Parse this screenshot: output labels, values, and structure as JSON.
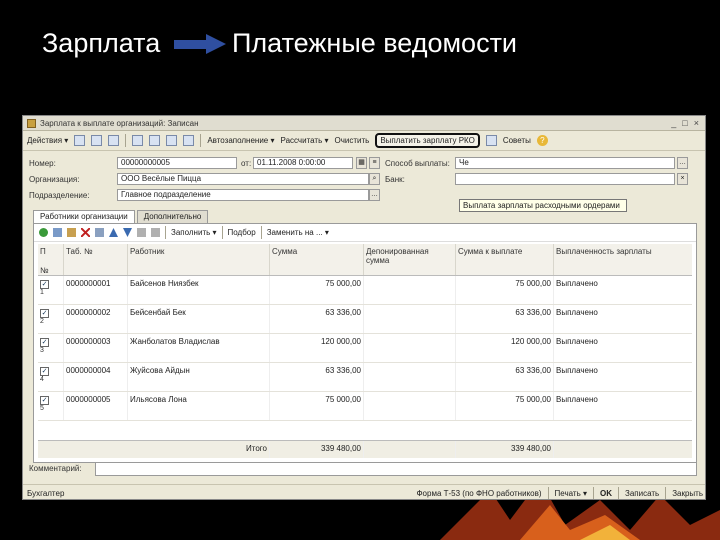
{
  "slide": {
    "crumb_from": "Зарплата",
    "crumb_to": "Платежные ведомости"
  },
  "window": {
    "title": "Зарплата к выплате организаций: Записан"
  },
  "toolbar": {
    "actions": "Действия",
    "autofill": "Автозаполнение",
    "calculate": "Рассчитать",
    "clear": "Очистить",
    "pay_rko": "Выплатить зарплату РКО",
    "tips": "Советы"
  },
  "form": {
    "number_label": "Номер:",
    "number_value": "00000000005",
    "date_label": "от:",
    "date_value": "01.11.2008 0:00:00",
    "payment_method_label": "Способ выплаты:",
    "payment_method_value": "Че",
    "org_label": "Организация:",
    "org_value": "ООО Весёлые Пицца",
    "bank_label": "Банк:",
    "dept_label": "Подразделение:",
    "dept_value": "Главное подразделение",
    "tooltip": "Выплата зарплаты расходными ордерами"
  },
  "tabs": [
    {
      "label": "Работники организации"
    },
    {
      "label": "Дополнительно"
    }
  ],
  "grid_toolbar": {
    "fill": "Заполнить",
    "select": "Подбор",
    "replace": "Заменить на ..."
  },
  "grid": {
    "headers": [
      "П",
      "Таб. №",
      "Работник",
      "Сумма",
      "Депонированная сумма",
      "Сумма к выплате",
      "Выплаченность зарплаты"
    ],
    "num_header": "№",
    "rows": [
      {
        "n": "1",
        "tab": "0000000001",
        "worker": "Байсенов Ниязбек",
        "sum": "75 000,00",
        "pay": "75 000,00",
        "status": "Выплачено"
      },
      {
        "n": "2",
        "tab": "0000000002",
        "worker": "Бейсенбай Бек",
        "sum": "63 336,00",
        "pay": "63 336,00",
        "status": "Выплачено"
      },
      {
        "n": "3",
        "tab": "0000000003",
        "worker": "Жанболатов Владислав",
        "sum": "120 000,00",
        "pay": "120 000,00",
        "status": "Выплачено"
      },
      {
        "n": "4",
        "tab": "0000000004",
        "worker": "Жуйсова Айдын",
        "sum": "63 336,00",
        "pay": "63 336,00",
        "status": "Выплачено"
      },
      {
        "n": "5",
        "tab": "0000000005",
        "worker": "Ильясова Лона",
        "sum": "75 000,00",
        "pay": "75 000,00",
        "status": "Выплачено"
      }
    ],
    "total_label": "Итого",
    "total_sum": "339 480,00",
    "total_pay": "339 480,00"
  },
  "comment_label": "Комментарий:",
  "bottom": {
    "author": "Бухгалтер",
    "print_form": "Форма Т-53 (по ФНО работников)",
    "print": "Печать",
    "ok": "OK",
    "save": "Записать",
    "close": "Закрыть"
  },
  "colors": {
    "slide_bg": "#000000",
    "arrow": "#2f4fa0",
    "window_bg": "#ece9d8"
  }
}
